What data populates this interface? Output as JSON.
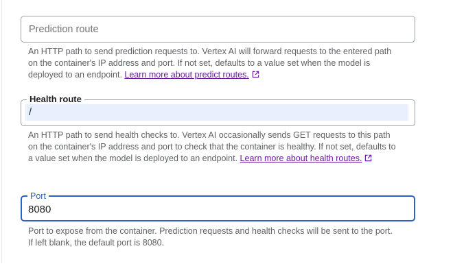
{
  "prediction_route": {
    "placeholder": "Prediction route",
    "value": "",
    "helper_text": "An HTTP path to send prediction requests to. Vertex AI will forward requests to the entered path on the container's IP address and port. If not set, defaults to a value set when the model is deployed to an endpoint. ",
    "link_text": "Learn more about predict routes.",
    "link_icon": "open-in-new-icon"
  },
  "health_route": {
    "label": "Health route",
    "value": "/",
    "helper_text": "An HTTP path to send health checks to. Vertex AI occasionally sends GET requests to this path on the container's IP address and port to check that the container is healthy. If not set, defaults to a value set when the model is deployed to an endpoint. ",
    "link_text": "Learn more about health routes.",
    "link_icon": "open-in-new-icon"
  },
  "port": {
    "label": "Port",
    "value": "8080",
    "helper_text": "Port to expose from the container. Prediction requests and health checks will be sent to the port. If left blank, the default port is 8080."
  },
  "colors": {
    "link": "#6a1b9a",
    "focus": "#2e5fc9",
    "outline": "#9aa0a6",
    "autofill_bg": "#e8f0fe"
  }
}
